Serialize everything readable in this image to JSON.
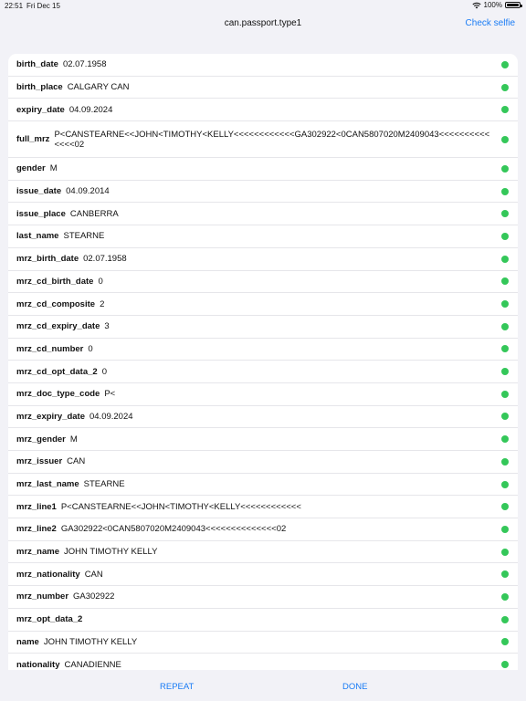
{
  "status_bar": {
    "time": "22:51",
    "date": "Fri Dec 15",
    "battery": "100%"
  },
  "nav": {
    "title": "can.passport.type1",
    "action": "Check selfie"
  },
  "rows": [
    {
      "key": "birth_date",
      "value": "02.07.1958"
    },
    {
      "key": "birth_place",
      "value": "CALGARY CAN"
    },
    {
      "key": "expiry_date",
      "value": "04.09.2024"
    },
    {
      "key": "full_mrz",
      "value": "P<CANSTEARNE<<JOHN<TIMOTHY<KELLY<<<<<<<<<<<<GA302922<0CAN5807020M2409043<<<<<<<<<<<<<<02"
    },
    {
      "key": "gender",
      "value": "M"
    },
    {
      "key": "issue_date",
      "value": "04.09.2014"
    },
    {
      "key": "issue_place",
      "value": "CANBERRA"
    },
    {
      "key": "last_name",
      "value": "STEARNE"
    },
    {
      "key": "mrz_birth_date",
      "value": "02.07.1958"
    },
    {
      "key": "mrz_cd_birth_date",
      "value": "0"
    },
    {
      "key": "mrz_cd_composite",
      "value": "2"
    },
    {
      "key": "mrz_cd_expiry_date",
      "value": "3"
    },
    {
      "key": "mrz_cd_number",
      "value": "0"
    },
    {
      "key": "mrz_cd_opt_data_2",
      "value": "0"
    },
    {
      "key": "mrz_doc_type_code",
      "value": "P<"
    },
    {
      "key": "mrz_expiry_date",
      "value": "04.09.2024"
    },
    {
      "key": "mrz_gender",
      "value": "M"
    },
    {
      "key": "mrz_issuer",
      "value": "CAN"
    },
    {
      "key": "mrz_last_name",
      "value": "STEARNE"
    },
    {
      "key": "mrz_line1",
      "value": "P<CANSTEARNE<<JOHN<TIMOTHY<KELLY<<<<<<<<<<<<"
    },
    {
      "key": "mrz_line2",
      "value": "GA302922<0CAN5807020M2409043<<<<<<<<<<<<<<02"
    },
    {
      "key": "mrz_name",
      "value": "JOHN TIMOTHY KELLY"
    },
    {
      "key": "mrz_nationality",
      "value": "CAN"
    },
    {
      "key": "mrz_number",
      "value": "GA302922"
    },
    {
      "key": "mrz_opt_data_2",
      "value": ""
    },
    {
      "key": "name",
      "value": "JOHN TIMOTHY KELLY"
    },
    {
      "key": "nationality",
      "value": "CANADIENNE"
    }
  ],
  "status_color": "#34c759",
  "accent_color": "#1a7cf5",
  "bottom": {
    "repeat_label": "REPEAT",
    "done_label": "DONE"
  }
}
